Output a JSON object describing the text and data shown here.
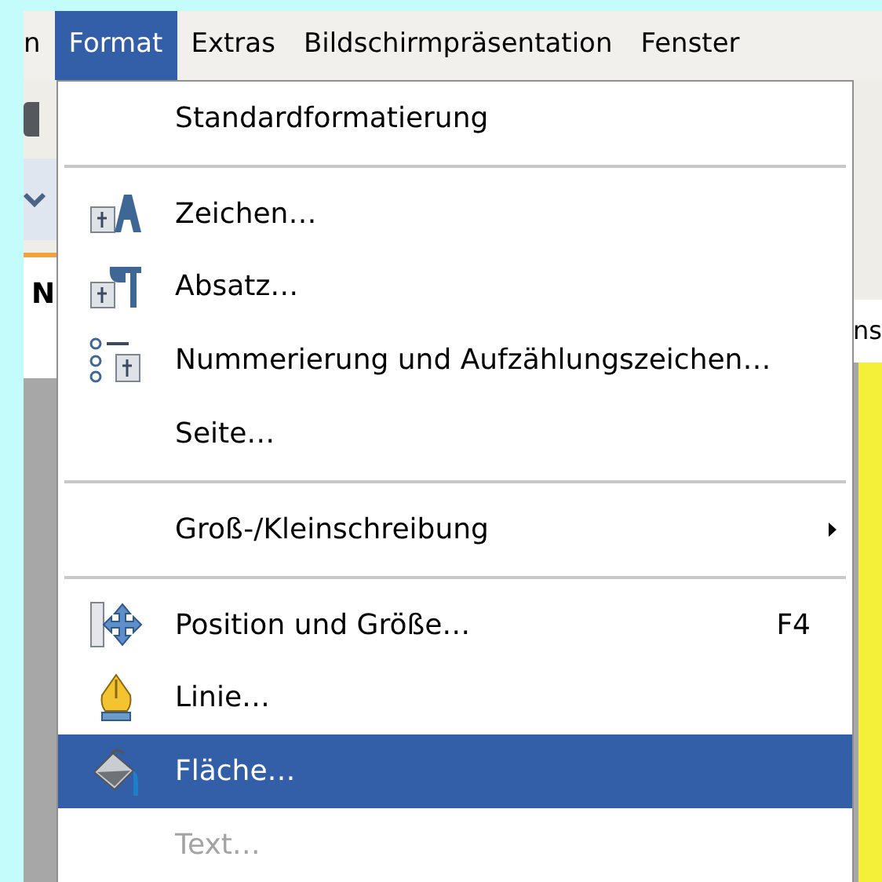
{
  "menubar": [
    {
      "label": "n",
      "selected": false
    },
    {
      "label": "Format",
      "selected": true
    },
    {
      "label": "Extras",
      "selected": false
    },
    {
      "label": "Bildschirmpräsentation",
      "selected": false
    },
    {
      "label": "Fenster",
      "selected": false
    }
  ],
  "background": {
    "left_tab_label": "N",
    "right_tab_label": "ns"
  },
  "menu": [
    {
      "kind": "item",
      "label": "Standardformatierung",
      "selected": false,
      "disabled": false
    },
    {
      "kind": "separator"
    },
    {
      "kind": "item",
      "label": "Zeichen…",
      "selected": false,
      "disabled": false
    },
    {
      "kind": "item",
      "label": "Absatz…",
      "selected": false,
      "disabled": false
    },
    {
      "kind": "item",
      "label": "Nummerierung und Aufzählungszeichen…",
      "selected": false,
      "disabled": false
    },
    {
      "kind": "item",
      "label": "Seite…",
      "selected": false,
      "disabled": false
    },
    {
      "kind": "separator"
    },
    {
      "kind": "submenu",
      "label": "Groß-/Kleinschreibung",
      "selected": false,
      "disabled": false
    },
    {
      "kind": "separator"
    },
    {
      "kind": "item",
      "label": "Position und Größe…",
      "shortcut": "F4",
      "selected": false,
      "disabled": false
    },
    {
      "kind": "item",
      "label": "Linie…",
      "selected": false,
      "disabled": false
    },
    {
      "kind": "item",
      "label": "Fläche…",
      "selected": true,
      "disabled": false
    },
    {
      "kind": "item",
      "label": "Text…",
      "selected": false,
      "disabled": true
    }
  ]
}
